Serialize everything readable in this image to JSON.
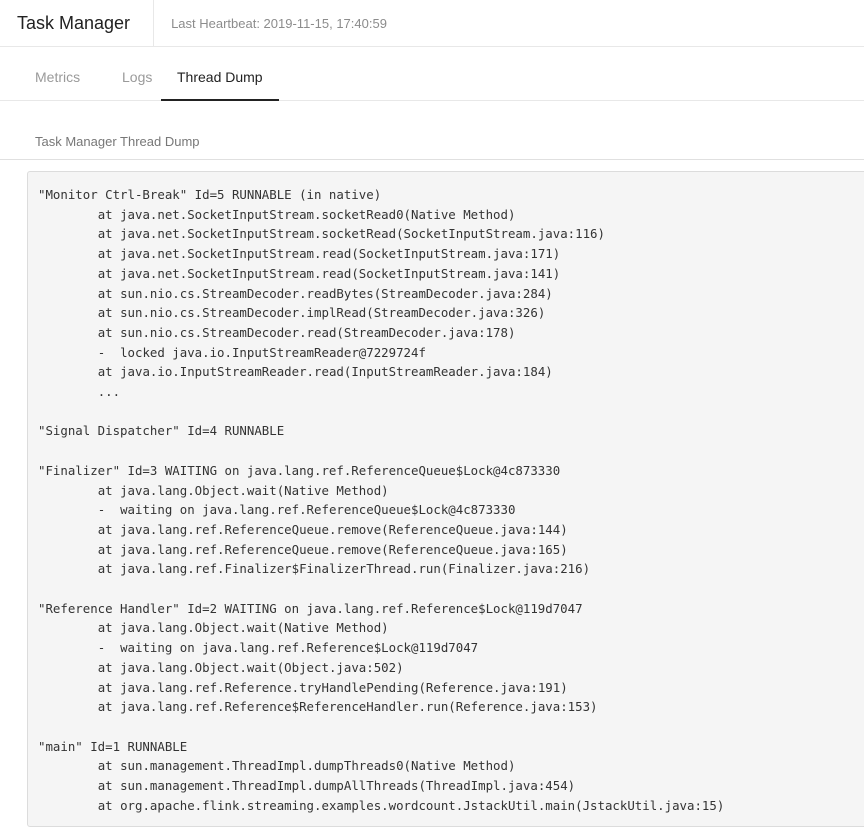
{
  "header": {
    "title": "Task Manager",
    "heartbeat": "Last Heartbeat: 2019-11-15, 17:40:59"
  },
  "tabs": [
    {
      "label": "Metrics",
      "active": false
    },
    {
      "label": "Logs",
      "active": false
    },
    {
      "label": "Thread Dump",
      "active": true
    }
  ],
  "section": {
    "title": "Task Manager Thread Dump"
  },
  "thread_dump": "\"Monitor Ctrl-Break\" Id=5 RUNNABLE (in native)\n\tat java.net.SocketInputStream.socketRead0(Native Method)\n\tat java.net.SocketInputStream.socketRead(SocketInputStream.java:116)\n\tat java.net.SocketInputStream.read(SocketInputStream.java:171)\n\tat java.net.SocketInputStream.read(SocketInputStream.java:141)\n\tat sun.nio.cs.StreamDecoder.readBytes(StreamDecoder.java:284)\n\tat sun.nio.cs.StreamDecoder.implRead(StreamDecoder.java:326)\n\tat sun.nio.cs.StreamDecoder.read(StreamDecoder.java:178)\n\t-  locked java.io.InputStreamReader@7229724f\n\tat java.io.InputStreamReader.read(InputStreamReader.java:184)\n\t...\n\n\"Signal Dispatcher\" Id=4 RUNNABLE\n\n\"Finalizer\" Id=3 WAITING on java.lang.ref.ReferenceQueue$Lock@4c873330\n\tat java.lang.Object.wait(Native Method)\n\t-  waiting on java.lang.ref.ReferenceQueue$Lock@4c873330\n\tat java.lang.ref.ReferenceQueue.remove(ReferenceQueue.java:144)\n\tat java.lang.ref.ReferenceQueue.remove(ReferenceQueue.java:165)\n\tat java.lang.ref.Finalizer$FinalizerThread.run(Finalizer.java:216)\n\n\"Reference Handler\" Id=2 WAITING on java.lang.ref.Reference$Lock@119d7047\n\tat java.lang.Object.wait(Native Method)\n\t-  waiting on java.lang.ref.Reference$Lock@119d7047\n\tat java.lang.Object.wait(Object.java:502)\n\tat java.lang.ref.Reference.tryHandlePending(Reference.java:191)\n\tat java.lang.ref.Reference$ReferenceHandler.run(Reference.java:153)\n\n\"main\" Id=1 RUNNABLE\n\tat sun.management.ThreadImpl.dumpThreads0(Native Method)\n\tat sun.management.ThreadImpl.dumpAllThreads(ThreadImpl.java:454)\n\tat org.apache.flink.streaming.examples.wordcount.JstackUtil.main(JstackUtil.java:15)"
}
